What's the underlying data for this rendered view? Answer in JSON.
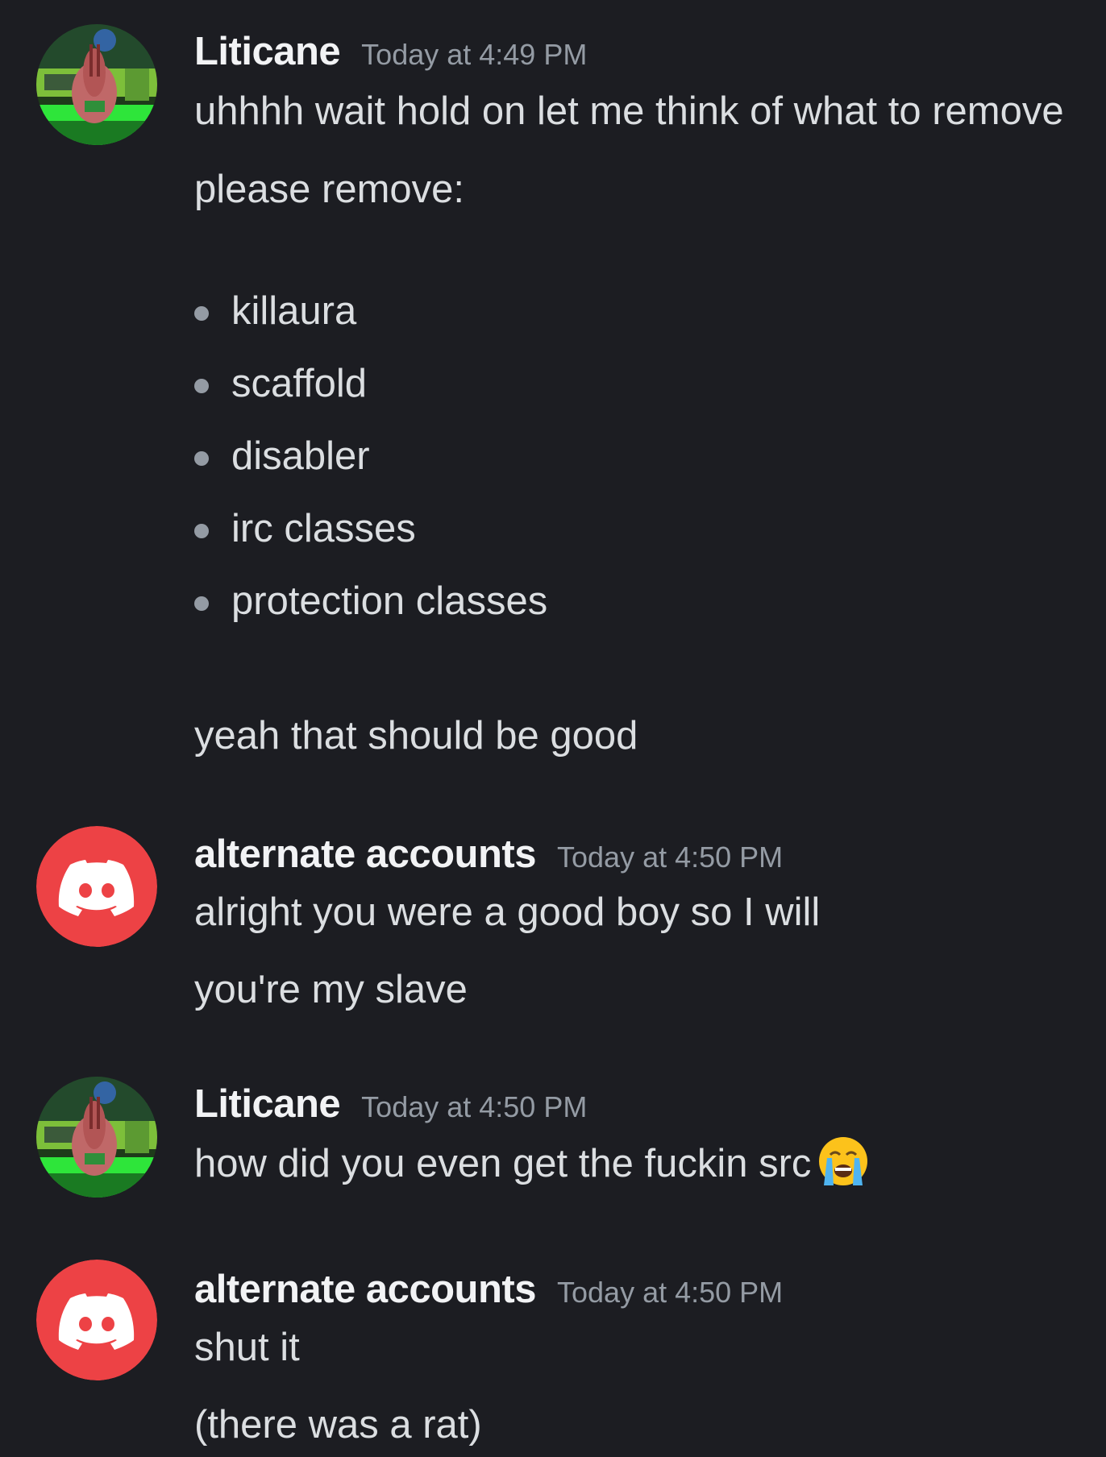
{
  "messages": [
    {
      "author": "Liticane",
      "timestamp": "Today at 4:49 PM",
      "avatar": "patrick-avatar",
      "lines": [
        "uhhhh wait hold on let me think of what to remove",
        "please remove:"
      ],
      "list": [
        "killaura",
        "scaffold",
        "disabler",
        "irc classes",
        "protection classes"
      ],
      "after_list": "yeah that should be good"
    },
    {
      "author": "alternate accounts",
      "timestamp": "Today at 4:50 PM",
      "avatar": "discord-logo-avatar",
      "lines": [
        "alright you were a good boy so I will",
        "you're my slave"
      ]
    },
    {
      "author": "Liticane",
      "timestamp": "Today at 4:50 PM",
      "avatar": "patrick-avatar",
      "lines": [
        "how did you even get the fuckin src"
      ],
      "emoji": "loudly-crying-face-icon"
    },
    {
      "author": "alternate accounts",
      "timestamp": "Today at 4:50 PM",
      "avatar": "discord-logo-avatar",
      "lines": [
        "shut it",
        "(there was a rat)"
      ]
    }
  ],
  "colors": {
    "background": "#1c1d22",
    "username": "#f2f3f5",
    "timestamp": "#949ba4",
    "text": "#dbdee1",
    "discord_red": "#ed4245"
  }
}
